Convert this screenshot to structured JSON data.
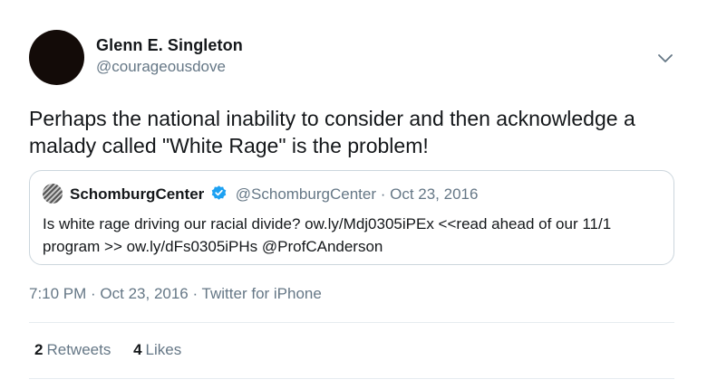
{
  "author": {
    "display_name": "Glenn E. Singleton",
    "handle": "@courageousdove"
  },
  "icons": {
    "menu": "chevron-down-icon",
    "verified": "verified-badge-icon"
  },
  "tweet": {
    "text": "Perhaps the national inability to consider and then acknowledge a malady called \"White Rage\" is the problem!",
    "timestamp": "7:10 PM · Oct 23, 2016 · Twitter for iPhone"
  },
  "quoted_tweet": {
    "name": "SchomburgCenter",
    "meta": "@SchomburgCenter · Oct 23, 2016",
    "text": "Is white rage driving our racial divide? ow.ly/Mdj0305iPEx <<read ahead of our 11/1 program >> ow.ly/dFs0305iPHs @ProfCAnderson"
  },
  "stats": {
    "retweets_count": "2",
    "retweets_label": "Retweets",
    "likes_count": "4",
    "likes_label": "Likes"
  },
  "colors": {
    "text": "#14171a",
    "secondary_text": "#657786",
    "border": "#ccd6dd",
    "divider": "#e6ecf0",
    "verified": "#1da1f2"
  }
}
